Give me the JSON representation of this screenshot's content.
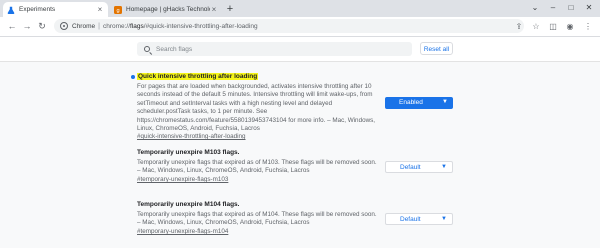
{
  "tabs": [
    {
      "title": "Experiments"
    },
    {
      "title": "Homepage | gHacks Technology News"
    }
  ],
  "omnibox": {
    "scheme_label": "Chrome",
    "url_prefix": "chrome://",
    "url_host": "flags",
    "url_rest": "/#quick-intensive-throttling-after-loading"
  },
  "header": {
    "search_placeholder": "Search flags",
    "reset_label": "Reset all"
  },
  "flags": [
    {
      "name": "Quick intensive throttling after loading",
      "highlighted": true,
      "description": "For pages that are loaded when backgrounded, activates intensive throttling after 10 seconds instead of the default 5 minutes. Intensive throttling will limit wake-ups, from setTimeout and setInterval tasks with a high nesting level and delayed scheduler.postTask tasks, to 1 per minute. See https://chromestatus.com/feature/5580139453743104 for more info. – Mac, Windows, Linux, ChromeOS, Android, Fuchsia, Lacros",
      "anchor": "#quick-intensive-throttling-after-loading",
      "value": "Enabled"
    },
    {
      "name": "Temporarily unexpire M103 flags.",
      "highlighted": false,
      "description": "Temporarily unexpire flags that expired as of M103. These flags will be removed soon. – Mac, Windows, Linux, ChromeOS, Android, Fuchsia, Lacros",
      "anchor": "#temporary-unexpire-flags-m103",
      "value": "Default"
    },
    {
      "name": "Temporarily unexpire M104 flags.",
      "highlighted": false,
      "description": "Temporarily unexpire flags that expired as of M104. These flags will be removed soon. – Mac, Windows, Linux, ChromeOS, Android, Fuchsia, Lacros",
      "anchor": "#temporary-unexpire-flags-m104",
      "value": "Default"
    }
  ],
  "colors": {
    "accent": "#1a73e8",
    "highlight": "#f5f518"
  }
}
